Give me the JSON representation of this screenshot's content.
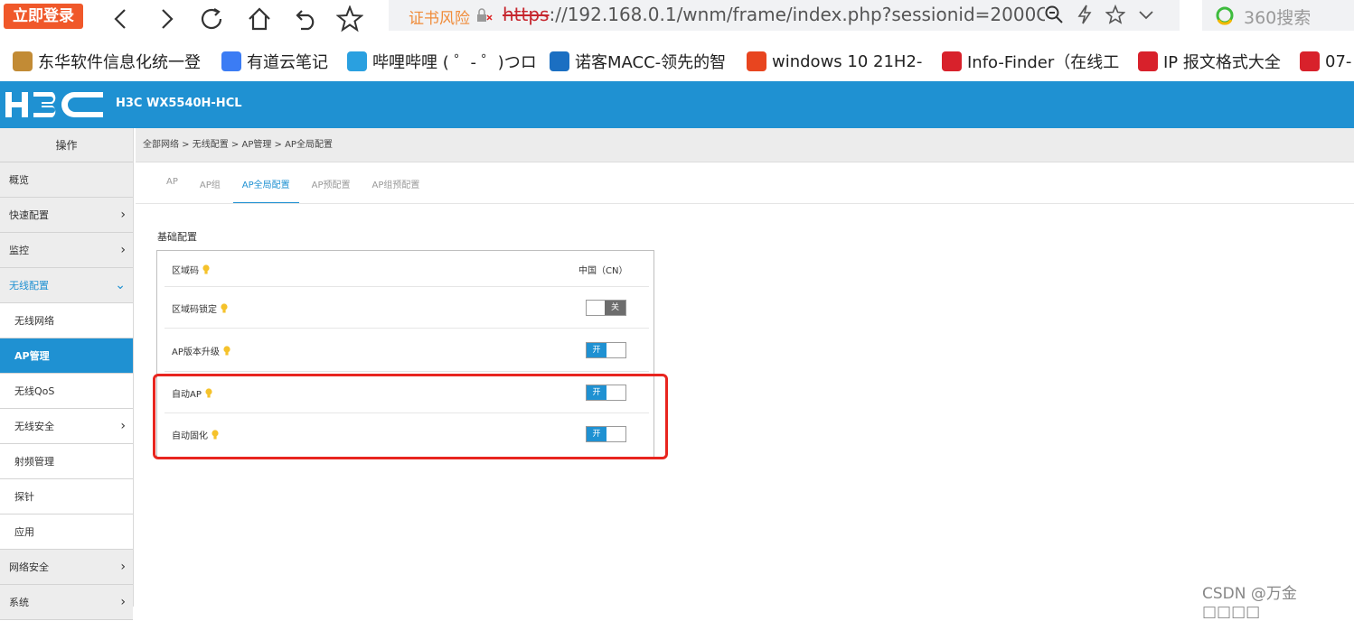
{
  "browser": {
    "login_label": "立即登录",
    "address": {
      "risk_label": "证书风险",
      "url_scheme": "https",
      "url_rest": "://192.168.0.1/wnm/frame/index.php?sessionid=2000C"
    },
    "search_placeholder": "360搜索",
    "bookmarks": [
      {
        "label": "东华软件信息化统一登",
        "icon": "donghua-icon"
      },
      {
        "label": "有道云笔记",
        "icon": "youdao-icon"
      },
      {
        "label": "哔哩哔哩 ( ゜- ゜)つロ",
        "icon": "bilibili-icon"
      },
      {
        "label": "诺客MACC-领先的智",
        "icon": "macc-icon"
      },
      {
        "label": "windows 10 21H2-",
        "icon": "windows-icon"
      },
      {
        "label": "Info-Finder（在线工",
        "icon": "huawei-icon"
      },
      {
        "label": "IP 报文格式大全",
        "icon": "huawei-icon"
      },
      {
        "label": "07-",
        "icon": "h3c-icon"
      }
    ]
  },
  "header": {
    "model": "H3C WX5540H-HCL"
  },
  "sidebar": {
    "heading": "操作",
    "items": [
      {
        "label": "概览",
        "chevron": ""
      },
      {
        "label": "快速配置",
        "chevron": "›"
      },
      {
        "label": "监控",
        "chevron": "›"
      },
      {
        "label": "无线配置",
        "chevron": "⌄"
      },
      {
        "label": "无线网络",
        "chevron": ""
      },
      {
        "label": "AP管理",
        "chevron": ""
      },
      {
        "label": "无线QoS",
        "chevron": ""
      },
      {
        "label": "无线安全",
        "chevron": "›"
      },
      {
        "label": "射频管理",
        "chevron": ""
      },
      {
        "label": "探针",
        "chevron": ""
      },
      {
        "label": "应用",
        "chevron": ""
      },
      {
        "label": "网络安全",
        "chevron": "›"
      },
      {
        "label": "系统",
        "chevron": "›"
      }
    ]
  },
  "main": {
    "breadcrumb": "全部网络 > 无线配置 > AP管理 > AP全局配置",
    "tabs": [
      "AP",
      "AP组",
      "AP全局配置",
      "AP预配置",
      "AP组预配置"
    ],
    "section_title": "基础配置",
    "rows": [
      {
        "label": "区域码",
        "value": "中国（CN）"
      },
      {
        "label": "区域码锁定",
        "switch_text": "关",
        "state": "off"
      },
      {
        "label": "AP版本升级",
        "switch_text": "开",
        "state": "on"
      },
      {
        "label": "自动AP",
        "switch_text": "开",
        "state": "on"
      },
      {
        "label": "自动固化",
        "switch_text": "开",
        "state": "on"
      }
    ]
  },
  "watermark": "CSDN @万金   □□□□",
  "colors": {
    "brand_blue": "#1f91d2",
    "highlight_red": "#e8251f",
    "login_orange": "#f0582a"
  }
}
